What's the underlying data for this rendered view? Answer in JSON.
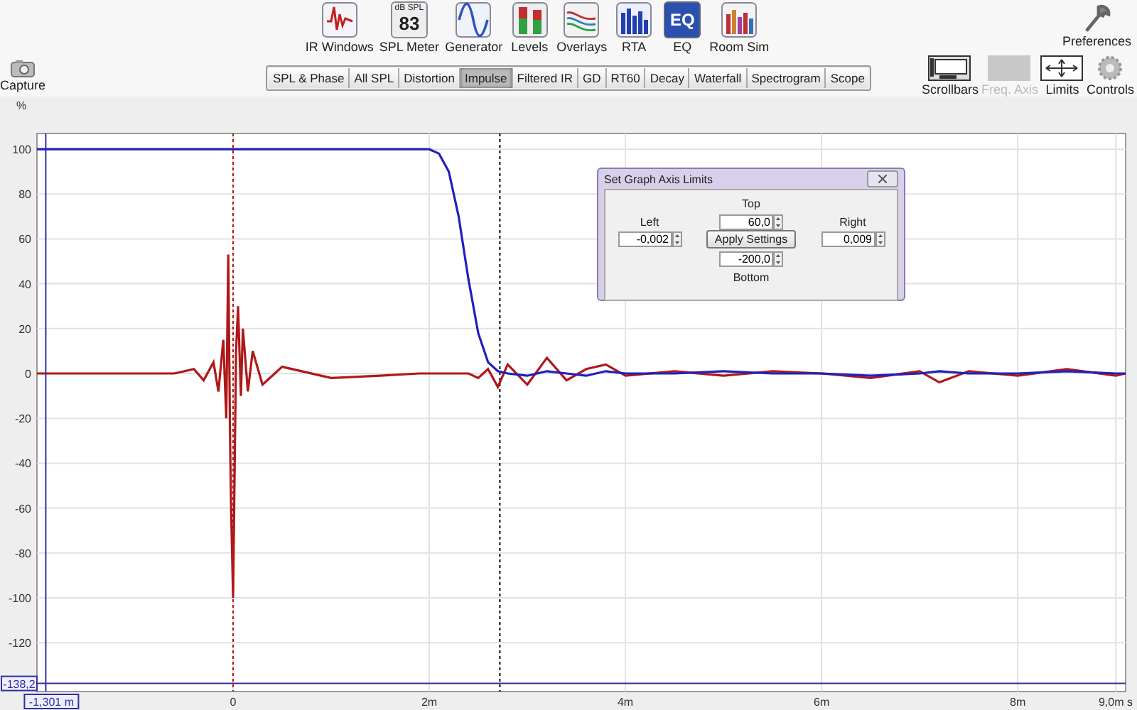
{
  "toolbar": {
    "tools": [
      {
        "kind": "ir",
        "label": "IR Windows"
      },
      {
        "kind": "meter",
        "label": "SPL Meter",
        "icon_caption": "dB SPL",
        "icon_value": "83"
      },
      {
        "kind": "generator",
        "label": "Generator"
      },
      {
        "kind": "levels",
        "label": "Levels"
      },
      {
        "kind": "overlays",
        "label": "Overlays"
      },
      {
        "kind": "rta",
        "label": "RTA"
      },
      {
        "kind": "eq",
        "label": "EQ",
        "icon_text": "EQ"
      },
      {
        "kind": "roomsim",
        "label": "Room Sim"
      }
    ],
    "preferences": {
      "label": "Preferences"
    }
  },
  "capture": {
    "label": "Capture"
  },
  "tabs": [
    {
      "label": "SPL & Phase",
      "selected": false
    },
    {
      "label": "All SPL",
      "selected": false
    },
    {
      "label": "Distortion",
      "selected": false
    },
    {
      "label": "Impulse",
      "selected": true
    },
    {
      "label": "Filtered IR",
      "selected": false
    },
    {
      "label": "GD",
      "selected": false
    },
    {
      "label": "RT60",
      "selected": false
    },
    {
      "label": "Decay",
      "selected": false
    },
    {
      "label": "Waterfall",
      "selected": false
    },
    {
      "label": "Spectrogram",
      "selected": false
    },
    {
      "label": "Scope",
      "selected": false
    }
  ],
  "view_tools": [
    {
      "kind": "scrollbars",
      "label": "Scrollbars",
      "disabled": false
    },
    {
      "kind": "freq_axis",
      "label": "Freq. Axis",
      "disabled": true
    },
    {
      "kind": "limits",
      "label": "Limits",
      "disabled": false
    },
    {
      "kind": "controls",
      "label": "Controls",
      "disabled": false
    }
  ],
  "graph": {
    "chart_data": {
      "type": "line",
      "ylabel": "%",
      "x": [
        -2.0,
        -0.6,
        -0.4,
        -0.3,
        -0.2,
        -0.15,
        -0.1,
        -0.07,
        -0.05,
        -0.03,
        -0.02,
        0,
        0.03,
        0.05,
        0.08,
        0.1,
        0.15,
        0.2,
        0.3,
        0.5,
        1.0,
        1.5,
        1.9,
        2.0,
        2.1,
        2.2,
        2.3,
        2.4,
        2.5,
        2.6,
        2.7,
        2.8,
        3.0,
        3.2,
        3.4,
        3.6,
        3.8,
        4.0,
        4.5,
        5.0,
        5.5,
        6.0,
        6.5,
        7.0,
        7.2,
        7.5,
        8.0,
        8.5,
        9.0,
        9.1
      ],
      "series": [
        {
          "color": "#b01818",
          "values": [
            0,
            0,
            2,
            -3,
            5,
            -8,
            15,
            -20,
            53,
            -30,
            -60,
            -100,
            10,
            30,
            -10,
            20,
            -8,
            10,
            -5,
            3,
            -2,
            -1,
            0,
            0,
            0,
            0,
            0,
            0,
            -2,
            2,
            -6,
            4,
            -5,
            7,
            -3,
            2,
            4,
            -1,
            1,
            -1,
            1,
            0,
            -2,
            1,
            -4,
            1,
            -1,
            2,
            -1,
            0
          ]
        },
        {
          "color": "#2020c0",
          "values": [
            100,
            100,
            100,
            100,
            100,
            100,
            100,
            100,
            100,
            100,
            100,
            100,
            100,
            100,
            100,
            100,
            100,
            100,
            100,
            100,
            100,
            100,
            100,
            100,
            98,
            90,
            70,
            42,
            18,
            5,
            1,
            0,
            -1,
            1,
            0,
            -1,
            1,
            0,
            0,
            1,
            0,
            0,
            -1,
            0,
            1,
            0,
            0,
            1,
            0,
            0
          ]
        }
      ],
      "xlim": [
        -2.0,
        9.1
      ],
      "ylim": [
        -141.8,
        107
      ],
      "xticks": [
        {
          "value": 0,
          "label": "0"
        },
        {
          "value": 2,
          "label": "2m"
        },
        {
          "value": 4,
          "label": "4m"
        },
        {
          "value": 6,
          "label": "6m"
        },
        {
          "value": 8,
          "label": "8m"
        },
        {
          "value": 9,
          "label": "9,0m s"
        }
      ],
      "yticks": [
        -120,
        -100,
        -80,
        -60,
        -40,
        -20,
        0,
        20,
        40,
        60,
        80,
        100
      ],
      "grid": true,
      "ref_lines": [
        {
          "axis": "x",
          "value": 0,
          "color": "#b01818"
        },
        {
          "axis": "x",
          "value": 2.72,
          "color": "#000000"
        },
        {
          "axis": "x",
          "value": -1.91,
          "color": "#3030a0",
          "label": "-1,301 m"
        },
        {
          "axis": "y",
          "value": -138.2,
          "color": "#3030a0",
          "label": "-138,2"
        }
      ]
    }
  },
  "dialog": {
    "title": "Set Graph Axis Limits",
    "apply_button": "Apply Settings",
    "fields": [
      {
        "kind": "top",
        "label": "Top",
        "value": "60,0"
      },
      {
        "kind": "left",
        "label": "Left",
        "value": "-0,002"
      },
      {
        "kind": "right",
        "label": "Right",
        "value": "0,009"
      },
      {
        "kind": "bottom",
        "label": "Bottom",
        "value": "-200,0"
      }
    ]
  }
}
